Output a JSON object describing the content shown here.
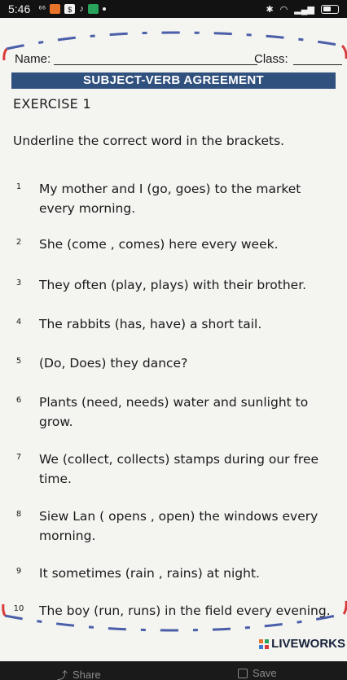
{
  "statusbar": {
    "time": "5:46",
    "icons": [
      "sim-icon",
      "notification-orange-icon",
      "notification-white-icon",
      "tiktok-icon",
      "notification-green-icon",
      "dot-icon",
      "wifi-icon",
      "bluetooth-icon",
      "signal-icon",
      "battery-icon"
    ]
  },
  "worksheet": {
    "name_label": "Name:",
    "class_label": "Class:",
    "banner": "SUBJECT-VERB AGREEMENT",
    "exercise": "EXERCISE 1",
    "instruction": "Underline the correct word in the brackets.",
    "questions": [
      {
        "num": "1",
        "text": "My mother and I (go, goes) to the market every morning."
      },
      {
        "num": "2",
        "text": "She (come , comes) here every week."
      },
      {
        "num": "3",
        "text": "They often (play, plays) with their brother."
      },
      {
        "num": "4",
        "text": "The rabbits (has, have) a short tail."
      },
      {
        "num": "5",
        "text": "(Do, Does) they dance?"
      },
      {
        "num": "6",
        "text": "Plants (need, needs) water and sunlight to grow."
      },
      {
        "num": "7",
        "text": "We (collect, collects) stamps during our free time."
      },
      {
        "num": "8",
        "text": "Siew Lan ( opens , open) the windows every morning."
      },
      {
        "num": "9",
        "text": "It sometimes (rain , rains) at night."
      },
      {
        "num": "10",
        "text": "The boy (run, runs) in the field every evening."
      }
    ],
    "logo": "LIVEWORKS",
    "colors": {
      "banner": "#30507e",
      "frame_dash": "#4a5fa8",
      "frame_red": "#d83a3a"
    }
  },
  "bottombar": {
    "share_label": "Share",
    "save_label": "Save"
  }
}
